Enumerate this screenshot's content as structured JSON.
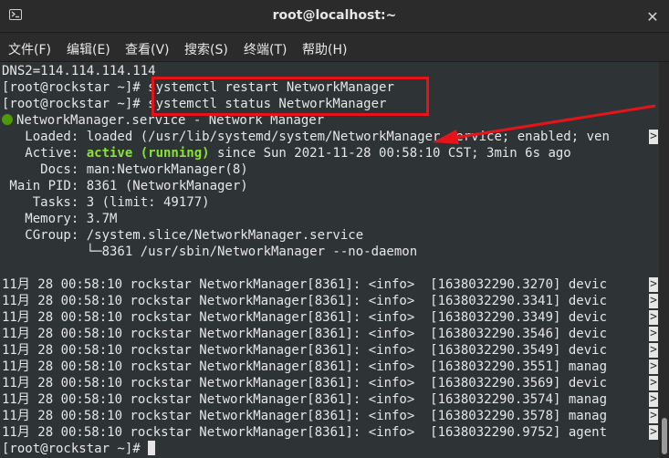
{
  "window": {
    "title": "root@localhost:~"
  },
  "menu": [
    {
      "label": "文件(F)"
    },
    {
      "label": "编辑(E)"
    },
    {
      "label": "查看(V)"
    },
    {
      "label": "搜索(S)"
    },
    {
      "label": "终端(T)"
    },
    {
      "label": "帮助(H)"
    }
  ],
  "terminal": {
    "dns_line": "DNS2=114.114.114.114",
    "prompt": "[root@rockstar ~]#",
    "cmd1": " systemctl restart NetworkManager",
    "cmd2": " systemctl status NetworkManager",
    "service_header": "NetworkManager.service - Network Manager",
    "loaded": "   Loaded: loaded (/usr/lib/systemd/system/NetworkManager.service; enabled; ven",
    "active_label": "   Active: ",
    "active_state": "active (running)",
    "active_rest": " since Sun 2021-11-28 00:58:10 CST; 3min 6s ago",
    "docs": "     Docs: man:NetworkManager(8)",
    "mainpid": " Main PID: 8361 (NetworkManager)",
    "tasks": "    Tasks: 3 (limit: 49177)",
    "memory": "   Memory: 3.7M",
    "cgroup": "   CGroup: /system.slice/NetworkManager.service",
    "cgroup_child": "           └─8361 /usr/sbin/NetworkManager --no-daemon",
    "log_lines": [
      "11月 28 00:58:10 rockstar NetworkManager[8361]: <info>  [1638032290.3270] devic",
      "11月 28 00:58:10 rockstar NetworkManager[8361]: <info>  [1638032290.3341] devic",
      "11月 28 00:58:10 rockstar NetworkManager[8361]: <info>  [1638032290.3349] devic",
      "11月 28 00:58:10 rockstar NetworkManager[8361]: <info>  [1638032290.3546] devic",
      "11月 28 00:58:10 rockstar NetworkManager[8361]: <info>  [1638032290.3549] devic",
      "11月 28 00:58:10 rockstar NetworkManager[8361]: <info>  [1638032290.3551] manag",
      "11月 28 00:58:10 rockstar NetworkManager[8361]: <info>  [1638032290.3569] devic",
      "11月 28 00:58:10 rockstar NetworkManager[8361]: <info>  [1638032290.3574] manag",
      "11月 28 00:58:10 rockstar NetworkManager[8361]: <info>  [1638032290.3578] manag",
      "11月 28 00:58:10 rockstar NetworkManager[8361]: <info>  [1638032290.9752] agent"
    ],
    "truncation_marker": ">",
    "final_prompt": "[root@rockstar ~]# "
  },
  "colors": {
    "background": "#2e3436",
    "foreground": "#e6e6e6",
    "active_green": "#8ae234",
    "highlight_red": "#e5141b"
  },
  "icons": {
    "window_icon": "terminal-icon",
    "close": "close-icon",
    "status_dot": "status-dot-icon"
  }
}
